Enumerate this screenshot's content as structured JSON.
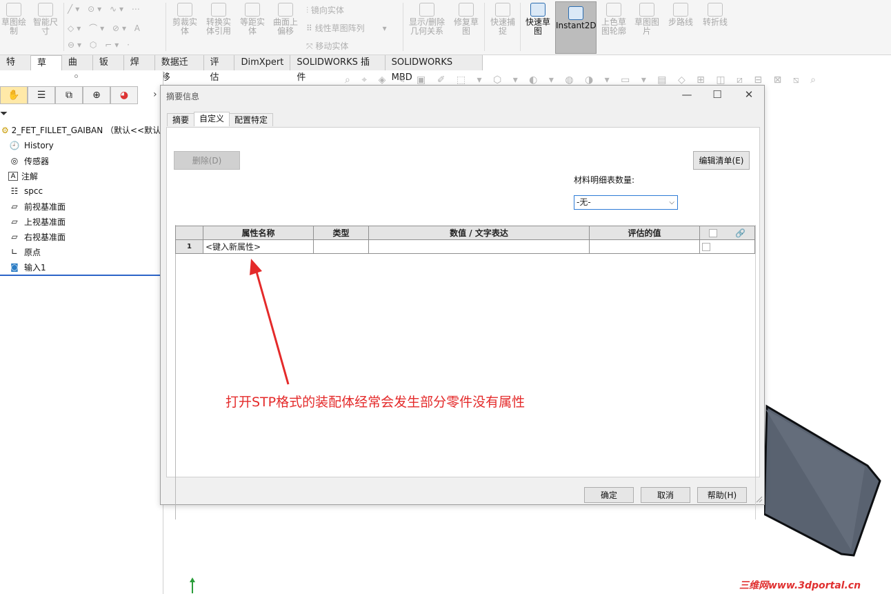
{
  "ribbon": {
    "sketch": "草图绘制",
    "smart_dim": "智能尺寸",
    "trim": "剪裁实体",
    "convert": "转换实体引用",
    "offset": "等距实体",
    "offset_surface": "曲面上偏移",
    "mirror": "镜向实体",
    "linear_pattern": "线性草图阵列",
    "move": "移动实体",
    "show_relations": "显示/删除几何关系",
    "repair": "修复草图",
    "quick_snap": "快速捕捉",
    "rapid_sketch": "快速草图",
    "instant2d": "Instant2D",
    "shaded_contour": "上色草图轮廓",
    "sketch_picture": "草图图片",
    "step_path": "步路线",
    "jog_line": "转折线"
  },
  "command_tabs": [
    "特征",
    "草图",
    "曲面",
    "钣金",
    "焊件",
    "数据迁移",
    "评估",
    "DimXpert",
    "SOLIDWORKS 插件",
    "SOLIDWORKS MBD"
  ],
  "tree": {
    "root": "2_FET_FILLET_GAIBAN （默认<<默认>_显",
    "items": [
      "History",
      "传感器",
      "注解",
      "spcc",
      "前视基准面",
      "上视基准面",
      "右视基准面",
      "原点",
      "输入1"
    ]
  },
  "dialog": {
    "title": "摘要信息",
    "tabs": [
      "摘要",
      "自定义",
      "配置特定"
    ],
    "delete_btn": "删除(D)",
    "bom_label": "材料明细表数量:",
    "bom_value": "-无-",
    "edit_list_btn": "编辑清单(E)",
    "table": {
      "headers": [
        "属性名称",
        "类型",
        "数值 / 文字表达",
        "评估的值"
      ],
      "row_num": "1",
      "placeholder": "<键入新属性>"
    },
    "ok": "确定",
    "cancel": "取消",
    "help": "帮助(H)"
  },
  "annotation": "打开STP格式的装配体经常会发生部分零件没有属性",
  "watermark": "三维网www.3dportal.cn",
  "colors": {
    "annotation": "#e42a2a",
    "selection_line": "#2b64c8"
  }
}
